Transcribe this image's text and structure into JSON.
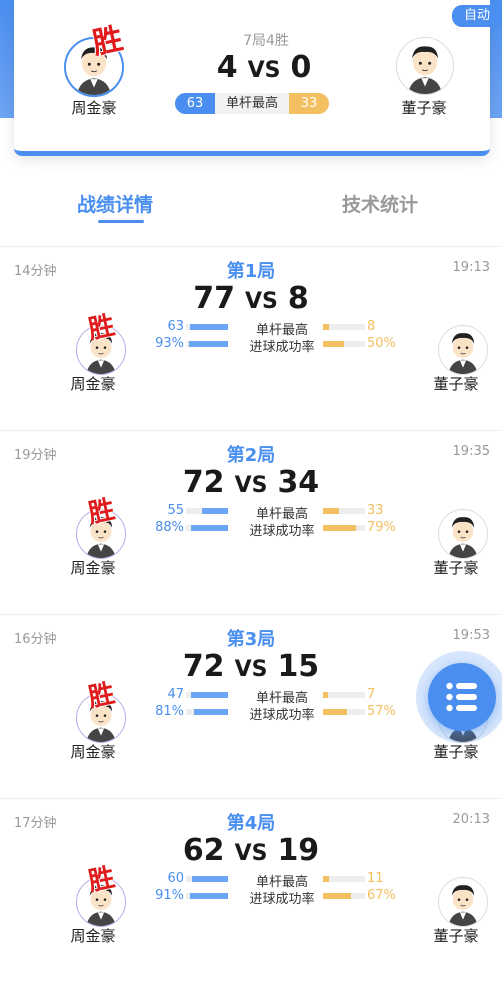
{
  "header": {
    "auto_label": "自动",
    "record": "7局4胜",
    "score_left": "4",
    "vs": "VS",
    "score_right": "0",
    "winner_mark": "胜",
    "player_left": "周金豪",
    "player_right": "董子豪",
    "best_break_label": "单杆最高",
    "best_break_left": "63",
    "best_break_right": "33"
  },
  "tabs": [
    {
      "label": "战绩详情",
      "active": true
    },
    {
      "label": "技术统计",
      "active": false
    }
  ],
  "stat_labels": {
    "best_break": "单杆最高",
    "success_rate": "进球成功率"
  },
  "games": [
    {
      "title": "第1局",
      "duration": "14分钟",
      "time": "19:13",
      "score_left": "77",
      "vs": "VS",
      "score_right": "8",
      "player_left": "周金豪",
      "player_right": "董子豪",
      "winner_mark": "胜",
      "best_left": "63",
      "best_right": "8",
      "rate_left": "93%",
      "rate_right": "50%",
      "best_left_fill": 0.9,
      "best_right_fill": 0.15,
      "rate_left_fill": 0.93,
      "rate_right_fill": 0.5
    },
    {
      "title": "第2局",
      "duration": "19分钟",
      "time": "19:35",
      "score_left": "72",
      "vs": "VS",
      "score_right": "34",
      "player_left": "周金豪",
      "player_right": "董子豪",
      "winner_mark": "胜",
      "best_left": "55",
      "best_right": "33",
      "rate_left": "88%",
      "rate_right": "79%",
      "best_left_fill": 0.62,
      "best_right_fill": 0.38,
      "rate_left_fill": 0.88,
      "rate_right_fill": 0.79
    },
    {
      "title": "第3局",
      "duration": "16分钟",
      "time": "19:53",
      "score_left": "72",
      "vs": "VS",
      "score_right": "15",
      "player_left": "周金豪",
      "player_right": "董子豪",
      "winner_mark": "胜",
      "best_left": "47",
      "best_right": "7",
      "rate_left": "81%",
      "rate_right": "57%",
      "best_left_fill": 0.87,
      "best_right_fill": 0.13,
      "rate_left_fill": 0.81,
      "rate_right_fill": 0.57
    },
    {
      "title": "第4局",
      "duration": "17分钟",
      "time": "20:13",
      "score_left": "62",
      "vs": "VS",
      "score_right": "19",
      "player_left": "周金豪",
      "player_right": "董子豪",
      "winner_mark": "胜",
      "best_left": "60",
      "best_right": "11",
      "rate_left": "91%",
      "rate_right": "67%",
      "best_left_fill": 0.85,
      "best_right_fill": 0.15,
      "rate_left_fill": 0.91,
      "rate_right_fill": 0.67
    }
  ],
  "colors": {
    "accent": "#4a8ff0",
    "opponent": "#f3c061",
    "winner": "#e01b1b"
  },
  "fab": {
    "icon": "list-menu-icon"
  }
}
